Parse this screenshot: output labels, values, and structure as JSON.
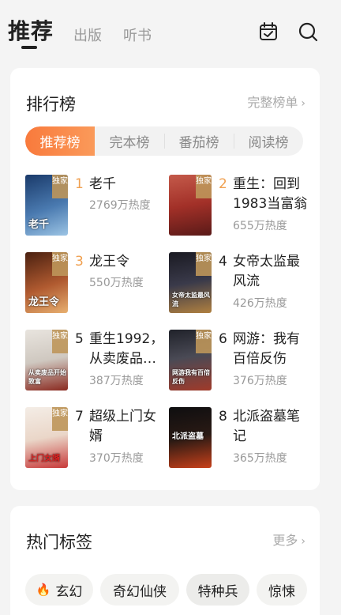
{
  "header": {
    "tabs": [
      {
        "label": "推荐"
      },
      {
        "label": "出版"
      },
      {
        "label": "听书"
      }
    ]
  },
  "ranking": {
    "title": "排行榜",
    "more_label": "完整榜单",
    "tabs": [
      {
        "label": "推荐榜"
      },
      {
        "label": "完本榜"
      },
      {
        "label": "番茄榜"
      },
      {
        "label": "阅读榜"
      }
    ],
    "badge_label": "独家",
    "books": [
      {
        "rank": "1",
        "title": "老千",
        "heat": "2769万热度",
        "cover_text": "老千"
      },
      {
        "rank": "2",
        "title": "重生：回到1983当富翁",
        "heat": "655万热度",
        "cover_text": ""
      },
      {
        "rank": "3",
        "title": "龙王令",
        "heat": "550万热度",
        "cover_text": "龙王令"
      },
      {
        "rank": "4",
        "title": "女帝太监最风流",
        "heat": "426万热度",
        "cover_text": "女帝太监最风流"
      },
      {
        "rank": "5",
        "title": "重生1992，从卖废品…",
        "heat": "387万热度",
        "cover_text": "从卖废品开始致富"
      },
      {
        "rank": "6",
        "title": "网游：我有百倍反伤",
        "heat": "376万热度",
        "cover_text": "网游我有百倍反伤"
      },
      {
        "rank": "7",
        "title": "超级上门女婿",
        "heat": "370万热度",
        "cover_text": "上门女婿"
      },
      {
        "rank": "8",
        "title": "北派盗墓笔记",
        "heat": "365万热度",
        "cover_text": "北派盗墓"
      }
    ]
  },
  "hot_tags": {
    "title": "热门标签",
    "more_label": "更多",
    "tags": [
      {
        "label": "玄幻",
        "icon": "fire-icon"
      },
      {
        "label": "奇幻仙侠"
      },
      {
        "label": "特种兵"
      },
      {
        "label": "惊悚"
      }
    ]
  },
  "colors": {
    "accent": "#f97a3c",
    "rank_top3": "#f0a050",
    "badge": "#be965a"
  }
}
